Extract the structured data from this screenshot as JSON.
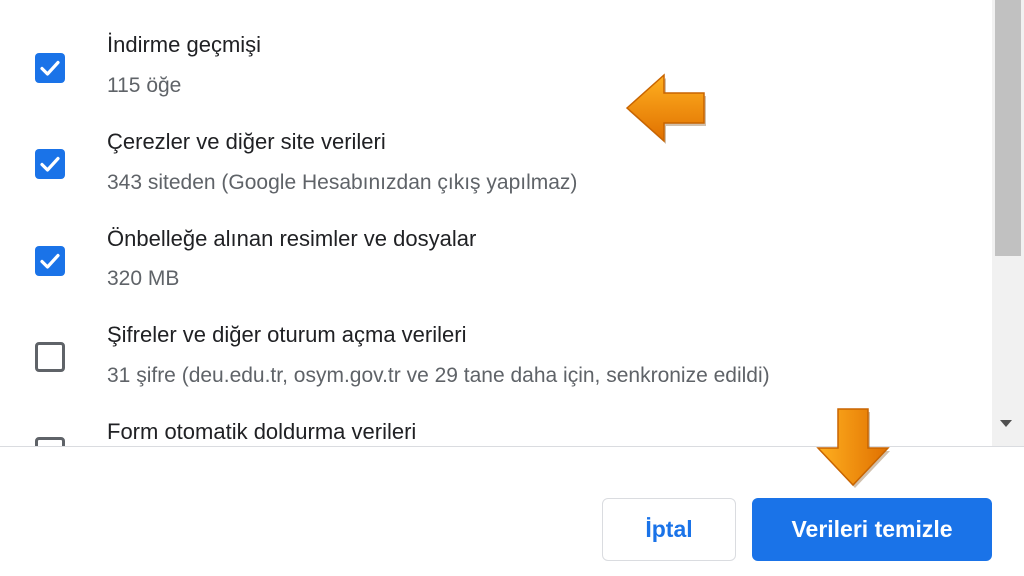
{
  "items": [
    {
      "title": "İndirme geçmişi",
      "subtitle": "115 öğe",
      "checked": true
    },
    {
      "title": "Çerezler ve diğer site verileri",
      "subtitle": "343 siteden (Google Hesabınızdan çıkış yapılmaz)",
      "checked": true
    },
    {
      "title": "Önbelleğe alınan resimler ve dosyalar",
      "subtitle": "320 MB",
      "checked": true
    },
    {
      "title": "Şifreler ve diğer oturum açma verileri",
      "subtitle": "31 şifre (deu.edu.tr, osym.gov.tr ve 29 tane daha için, senkronize edildi)",
      "checked": false
    },
    {
      "title": "Form otomatik doldurma verileri",
      "subtitle": "",
      "checked": false
    }
  ],
  "buttons": {
    "cancel_label": "İptal",
    "clear_label": "Verileri temizle"
  },
  "colors": {
    "accent": "#1a73e8",
    "annotation_arrow": "#f08c00"
  },
  "icons": {
    "checkbox_checked": "checkmark-icon",
    "scroll_down": "scroll-down-arrow-icon",
    "annotation": "orange-arrow-icon"
  }
}
